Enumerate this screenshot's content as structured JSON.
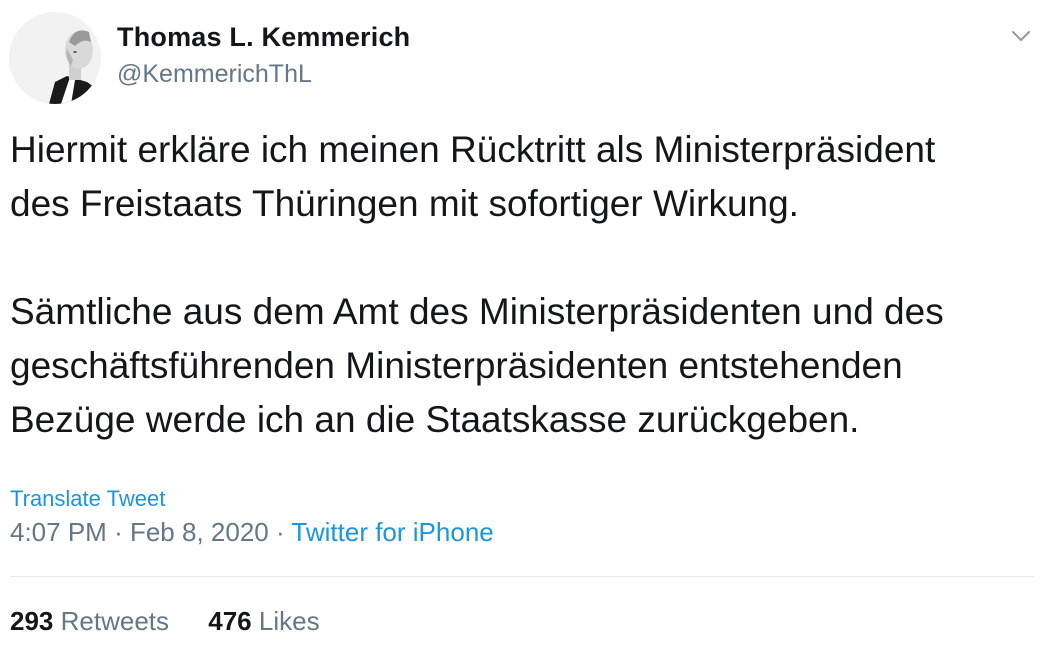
{
  "user": {
    "display_name": "Thomas L. Kemmerich",
    "handle": "@KemmerichThL"
  },
  "tweet": {
    "paragraphs": [
      [
        "Hiermit erkläre ich meinen Rücktritt als Ministerpräsident",
        "des Freistaats Thüringen mit sofortiger Wirkung."
      ],
      [
        "Sämtliche aus dem Amt des Ministerpräsidenten und des",
        "geschäftsführenden Ministerpräsidenten entstehenden",
        "Bezüge werde ich an die Staatskasse zurückgeben."
      ]
    ],
    "translate_label": "Translate Tweet",
    "time": "4:07 PM",
    "date": "Feb 8, 2020",
    "separator": "·",
    "source": "Twitter for iPhone"
  },
  "stats": {
    "retweets_count": "293",
    "retweets_label": "Retweets",
    "likes_count": "476",
    "likes_label": "Likes"
  },
  "icons": {
    "menu": "chevron-down-icon",
    "avatar": "avatar-photo"
  },
  "colors": {
    "text": "#14171a",
    "secondary": "#657786",
    "link": "#1b95e0",
    "divider": "#e6ecf0"
  }
}
